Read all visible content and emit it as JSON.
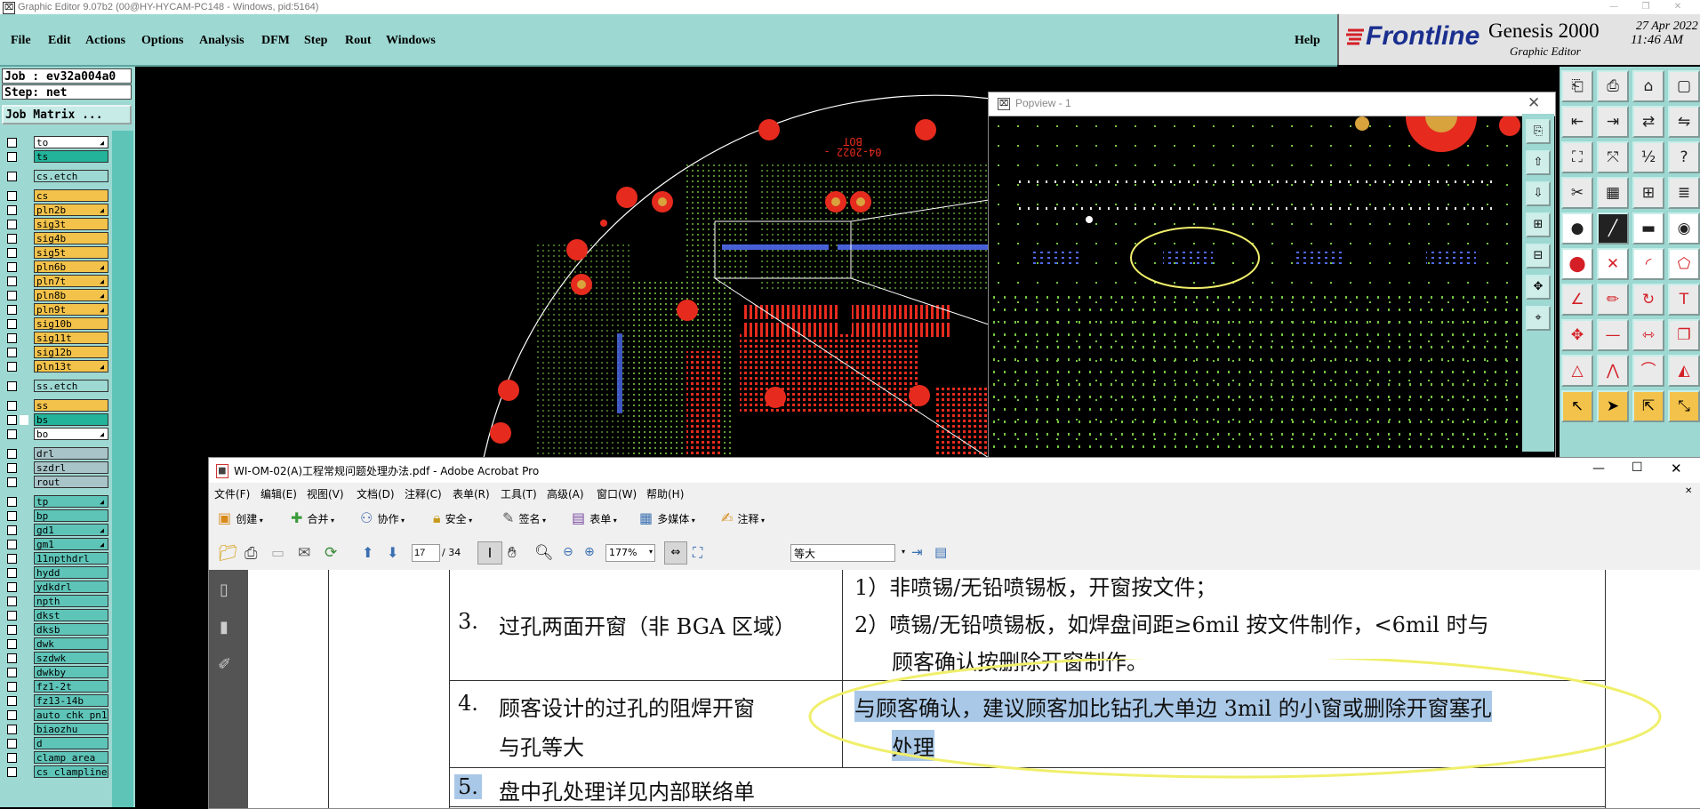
{
  "window": {
    "title": "Graphic Editor 9.07b2 (00@HY-HYCAM-PC148 - Windows, pid:5164)"
  },
  "menu": [
    "File",
    "Edit",
    "Actions",
    "Options",
    "Analysis",
    "DFM",
    "Step",
    "Rout",
    "Windows"
  ],
  "help_label": "Help",
  "brand": {
    "logo": "Frontline",
    "product": "Genesis 2000",
    "subtitle": "Graphic Editor",
    "date": "27 Apr 2022",
    "time": "11:46 AM"
  },
  "job": {
    "job_label": "Job : ev32a004a0",
    "step_label": "Step: net",
    "matrix_button": "Job Matrix ..."
  },
  "colors": {
    "signal": "#f3c24a",
    "outer": "#22b39a",
    "mask": "#9dd8d2",
    "drill": "#a8c4c8",
    "board": "#5ec4b8",
    "pad": "#e62b1e",
    "grid": "#76c442",
    "bga": "#4f6af0",
    "highlight": "#a9c8e8",
    "ellipse": "#f0ef6b"
  },
  "layers": [
    {
      "name": "to",
      "color": "#ffffff",
      "tick": true
    },
    {
      "name": "ts",
      "color": "#22b39a",
      "tick": false
    },
    {
      "name": "cs.etch",
      "color": "#9dd8d2",
      "tick": false
    },
    {
      "name": "cs",
      "color": "#f3c24a",
      "tick": false
    },
    {
      "name": "pln2b",
      "color": "#f3c24a",
      "tick": true
    },
    {
      "name": "sig3t",
      "color": "#f3c24a",
      "tick": false
    },
    {
      "name": "sig4b",
      "color": "#f3c24a",
      "tick": false
    },
    {
      "name": "sig5t",
      "color": "#f3c24a",
      "tick": false
    },
    {
      "name": "pln6b",
      "color": "#f3c24a",
      "tick": true
    },
    {
      "name": "pln7t",
      "color": "#f3c24a",
      "tick": true
    },
    {
      "name": "pln8b",
      "color": "#f3c24a",
      "tick": true
    },
    {
      "name": "pln9t",
      "color": "#f3c24a",
      "tick": true
    },
    {
      "name": "sig10b",
      "color": "#f3c24a",
      "tick": false
    },
    {
      "name": "sig11t",
      "color": "#f3c24a",
      "tick": false
    },
    {
      "name": "sig12b",
      "color": "#f3c24a",
      "tick": false
    },
    {
      "name": "pln13t",
      "color": "#f3c24a",
      "tick": true
    },
    {
      "name": "ss.etch",
      "color": "#9dd8d2",
      "tick": false
    },
    {
      "name": "ss",
      "color": "#f3c24a",
      "tick": false
    },
    {
      "name": "bs",
      "color": "#22b39a",
      "tick": false
    },
    {
      "name": "bo",
      "color": "#ffffff",
      "tick": true
    },
    {
      "name": "drl",
      "color": "#a8c4c8",
      "tick": false
    },
    {
      "name": "szdrl",
      "color": "#a8c4c8",
      "tick": false
    },
    {
      "name": "rout",
      "color": "#a8c4c8",
      "tick": false
    },
    {
      "name": "tp",
      "color": "#5ec4b8",
      "tick": true
    },
    {
      "name": "bp",
      "color": "#5ec4b8",
      "tick": false
    },
    {
      "name": "gd1",
      "color": "#5ec4b8",
      "tick": true
    },
    {
      "name": "gm1",
      "color": "#5ec4b8",
      "tick": true
    },
    {
      "name": "11npthdrl",
      "color": "#5ec4b8",
      "tick": false
    },
    {
      "name": "hydd",
      "color": "#5ec4b8",
      "tick": false
    },
    {
      "name": "ydkdrl",
      "color": "#5ec4b8",
      "tick": false
    },
    {
      "name": "npth",
      "color": "#5ec4b8",
      "tick": false
    },
    {
      "name": "dkst",
      "color": "#5ec4b8",
      "tick": false
    },
    {
      "name": "dksb",
      "color": "#5ec4b8",
      "tick": false
    },
    {
      "name": "dwk",
      "color": "#5ec4b8",
      "tick": false
    },
    {
      "name": "szdwk",
      "color": "#5ec4b8",
      "tick": false
    },
    {
      "name": "dwkby",
      "color": "#5ec4b8",
      "tick": false
    },
    {
      "name": "fz1-2t",
      "color": "#5ec4b8",
      "tick": false
    },
    {
      "name": "fz13-14b",
      "color": "#5ec4b8",
      "tick": false
    },
    {
      "name": "auto_chk_pn1",
      "color": "#5ec4b8",
      "tick": false
    },
    {
      "name": "biaozhu",
      "color": "#5ec4b8",
      "tick": false
    },
    {
      "name": "d",
      "color": "#5ec4b8",
      "tick": false
    },
    {
      "name": "clamp_area",
      "color": "#5ec4b8",
      "tick": false
    },
    {
      "name": "cs_clampline",
      "color": "#5ec4b8",
      "tick": false
    }
  ],
  "canvas_label": "04-2022 -BOT",
  "popview": {
    "title": "Popview - 1"
  },
  "acrobat": {
    "title": "WI-OM-02(A)工程常规问题处理办法.pdf - Adobe Acrobat Pro",
    "menu": [
      "文件(F)",
      "编辑(E)",
      "视图(V)",
      "文档(D)",
      "注释(C)",
      "表单(R)",
      "工具(T)",
      "高级(A)",
      "窗口(W)",
      "帮助(H)"
    ],
    "toolbar": [
      "创建",
      "合并",
      "协作",
      "安全",
      "签名",
      "表单",
      "多媒体",
      "注释"
    ],
    "page_current": "17",
    "page_total": "/ 34",
    "zoom": "177%",
    "font_select": "等大",
    "rows": [
      {
        "num": "3.",
        "left": "过孔两面开窗（非 BGA 区域）",
        "right1": "1）非喷锡/无铅喷锡板，开窗按文件；",
        "right2": "2）喷锡/无铅喷锡板，如焊盘间距≥6mil 按文件制作，<6mil 时与",
        "right3": "顾客确认按删除开窗制作。"
      },
      {
        "num": "4.",
        "left1": "顾客设计的过孔的阻焊开窗",
        "left2": "与孔等大",
        "right1": "与顾客确认，建议顾客加比钻孔大单边 3mil 的小窗或删除开窗塞孔",
        "right2": "处理"
      },
      {
        "num": "5.",
        "left": "盘中孔处理详见内部联络单"
      }
    ]
  }
}
